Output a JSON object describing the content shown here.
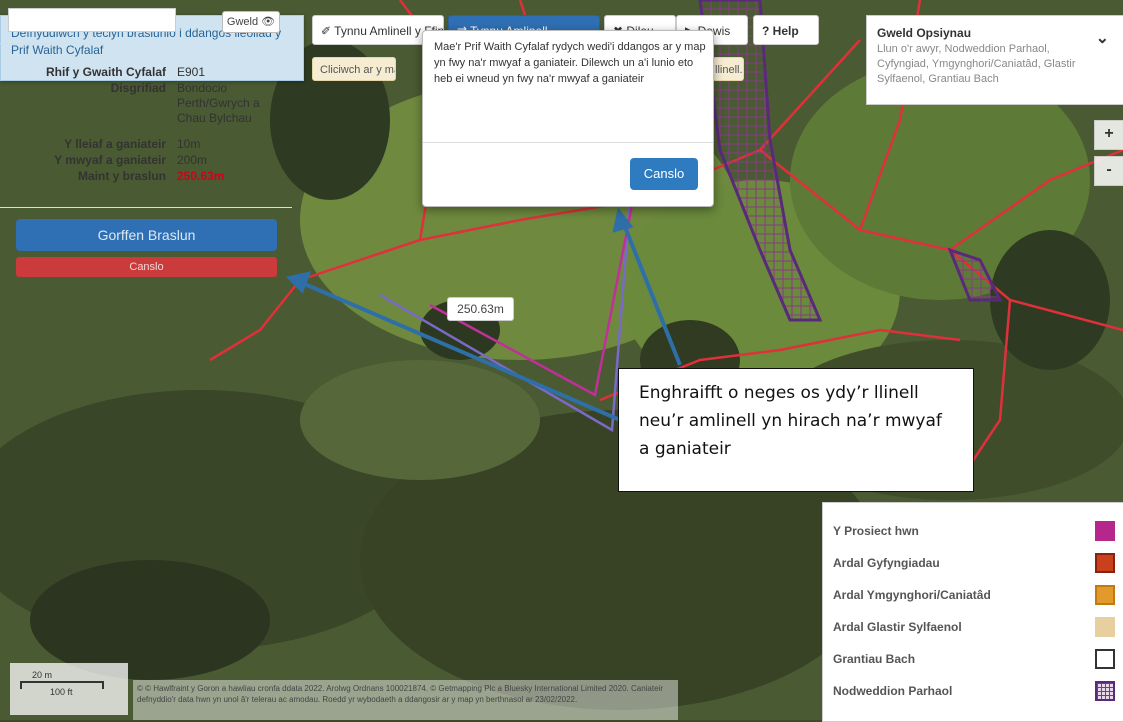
{
  "hint": "Defnyddiwch y teclyn braslunio i ddangos lleoliad y Prif Waith Cyfalaf",
  "toolbar": {
    "draw_outline": "✐ Tynnu Amlinell y Ffin",
    "draw_line": "⇄ Tynnu Amlinell",
    "delete": "✖ Dileu",
    "select": "▶ Dewis",
    "help": "? Help",
    "tip_left": "Cliciwch ar y map",
    "tip_right": "llinell."
  },
  "info_panel": {
    "view_button": "Gweld 👁",
    "rows": [
      {
        "key": "Rhif y Gwaith Cyfalaf",
        "value": "E901"
      },
      {
        "key": "Disgrifiad",
        "value": "Bondocio Perth/Gwrych a Chau Bylchau"
      },
      {
        "key": "Y lleiaf a ganiateir",
        "value": "10m"
      },
      {
        "key": "Y mwyaf a ganiateir",
        "value": "200m"
      },
      {
        "key": "Maint y braslun",
        "value": "250.63m"
      }
    ],
    "finish_button": "Gorffen Braslun",
    "cancel_button": "Canslo"
  },
  "modal": {
    "message": "Mae'r Prif Waith Cyfalaf rydych wedi'i ddangos ar y map yn fwy na'r mwyaf a ganiateir. Dilewch un a'i lunio eto heb ei wneud yn fwy na'r mwyaf a ganiateir",
    "cancel_button": "Canslo"
  },
  "options": {
    "title": "Gweld Opsiynau",
    "description": "Llun o'r awyr, Nodweddion Parhaol, Cyfyngiad, Ymgynghori/Caniatâd, Glastir Sylfaenol, Grantiau Bach"
  },
  "zoom": {
    "in": "+",
    "out": "-"
  },
  "length_label": "250.63m",
  "callout": "Enghraifft o neges os ydy’r llinell neu’r amlinell yn hirach na’r mwyaf a ganiateir",
  "legend": [
    {
      "label": "Y Prosiect hwn",
      "color": "#b5278a"
    },
    {
      "label": "Ardal Gyfyngiadau",
      "color": "#c8401c"
    },
    {
      "label": "Ardal Ymgynghori/Caniatâd",
      "color": "#e39a2c"
    },
    {
      "label": "Ardal Glastir Sylfaenol",
      "color": "#e8cfa0"
    },
    {
      "label": "Grantiau Bach",
      "color": "#333333"
    },
    {
      "label": "Nodweddion Parhaol",
      "color": "#7a3a86"
    }
  ],
  "scale": {
    "metric": "20 m",
    "imperial": "100 ft"
  },
  "attribution": "© © Hawlfraint y Goron a hawliau cronfa ddata 2022. Arolwg Ordnans 100021874. © Getmapping Plc a Bluesky International Limited 2020. Caniateir defnyddio'r data hwn yn unol â'r telerau ac amodau. Roedd yr wybodaeth a ddangosir ar y map yn berthnasol ar 23/02/2022."
}
